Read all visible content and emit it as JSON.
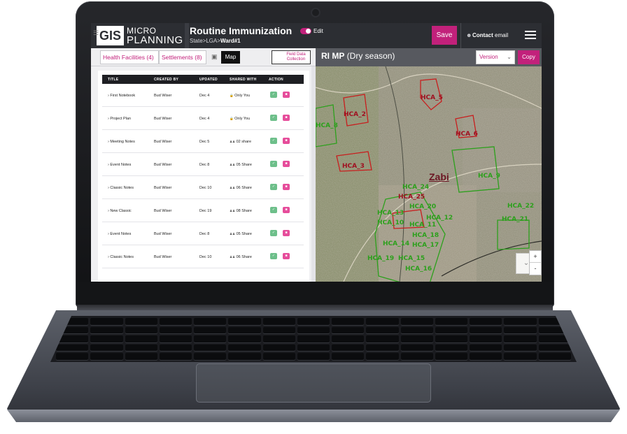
{
  "app": {
    "logo_gis": "GIS",
    "logo_micro": "MICRO",
    "logo_planning": "PLANNING",
    "title": "Routine Immunization",
    "breadcrumb_prefix": "State>LGA>",
    "breadcrumb_current": "Ward#1",
    "edit_label": "Edit",
    "save_label": "Save",
    "contact_bold": "Contact",
    "contact_rest": " email"
  },
  "toolbar": {
    "tab_health": "Health Facilities (4)",
    "tab_settlements": "Settlements (8)",
    "map_label": "Map",
    "field_data_line1": "Field Data",
    "field_data_line2": "Collection",
    "map_title_bold": "RI MP",
    "map_title_rest": " (Dry season)",
    "version_label": "Version",
    "copy_label": "Copy"
  },
  "table": {
    "headers": {
      "title": "TITLE",
      "created_by": "CREATED BY",
      "updated": "UPDATED",
      "shared_with": "SHARED WITH",
      "action": "ACTION"
    },
    "rows": [
      {
        "title": "First Notebook",
        "created_by": "Bud Wiser",
        "updated": "Dec 4",
        "shared": "Only You",
        "shared_icon": "lock-icon"
      },
      {
        "title": "Project Plan",
        "created_by": "Bud Wiser",
        "updated": "Dec 4",
        "shared": "Only You",
        "shared_icon": "lock-icon"
      },
      {
        "title": "Meeting Notes",
        "created_by": "Bud Wiser",
        "updated": "Dec 5",
        "shared": "02 share",
        "shared_icon": "users-icon"
      },
      {
        "title": "Event Notes",
        "created_by": "Bud Wiser",
        "updated": "Dec 8",
        "shared": "05 Share",
        "shared_icon": "users-icon"
      },
      {
        "title": "Classic Notes",
        "created_by": "Bud Wiser",
        "updated": "Dec 10",
        "shared": "06 Share",
        "shared_icon": "users-icon"
      },
      {
        "title": "New Classic",
        "created_by": "Bud Wiser",
        "updated": "Dec 19",
        "shared": "08 Share",
        "shared_icon": "users-icon"
      },
      {
        "title": "Event Notes",
        "created_by": "Bud Wiser",
        "updated": "Dec 8",
        "shared": "05 Share",
        "shared_icon": "users-icon"
      },
      {
        "title": "Classic Notes",
        "created_by": "Bud Wiser",
        "updated": "Dec 10",
        "shared": "06 Share",
        "shared_icon": "users-icon"
      }
    ]
  },
  "map": {
    "town_label": "Zabi",
    "red_areas": [
      "HCA_5",
      "HCA_2",
      "HCA_6",
      "HCA_3",
      "HCA_25"
    ],
    "green_areas": [
      "HCA_8",
      "HCA_9",
      "HCA_24",
      "HCA_20",
      "HCA_13",
      "HCA_12",
      "HCA_10",
      "HCA_11",
      "HCA_18",
      "HCA_14",
      "HCA_17",
      "HCA_19",
      "HCA_15",
      "HCA_16",
      "HCA_22",
      "HCA_21"
    ],
    "zoom_in": "+",
    "zoom_out": "-"
  },
  "colors": {
    "accent": "#c2217b",
    "header_bg": "#2c2e33",
    "green_area": "#2ca01c",
    "red_area": "#a01020"
  }
}
